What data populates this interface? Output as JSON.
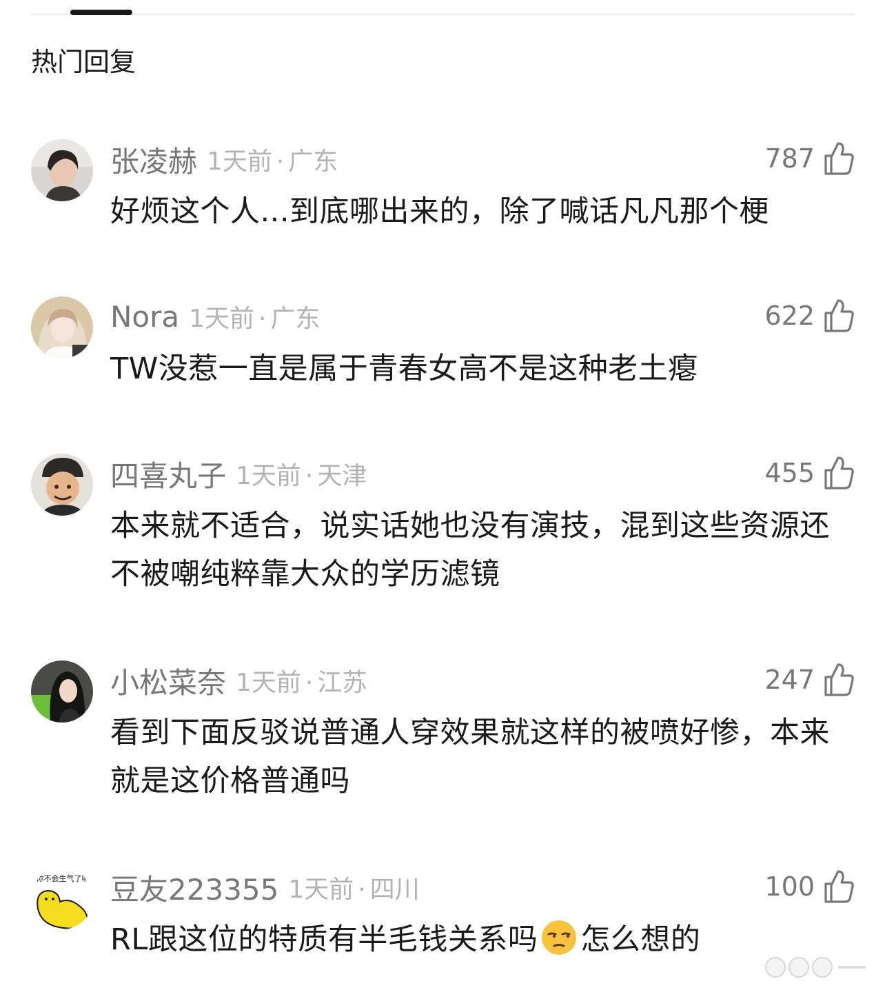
{
  "section": {
    "title": "热门回复"
  },
  "comments": [
    {
      "username": "张凌赫",
      "time": "1天前",
      "location": "广东",
      "likes": "787",
      "text": "好烦这个人...到底哪出来的，除了喊话凡凡那个梗",
      "avatar": "avatar-young-man"
    },
    {
      "username": "Nora",
      "time": "1天前",
      "location": "广东",
      "likes": "622",
      "text": "TW没惹一直是属于青春女高不是这种老土瘪",
      "avatar": "avatar-young-woman"
    },
    {
      "username": "四喜丸子",
      "time": "1天前",
      "location": "天津",
      "likes": "455",
      "text": "本来就不适合，说实话她也没有演技，混到这些资源还不被嘲纯粹靠大众的学历滤镜",
      "avatar": "avatar-man-with-cap"
    },
    {
      "username": "小松菜奈",
      "time": "1天前",
      "location": "江苏",
      "likes": "247",
      "text": "看到下面反驳说普通人穿效果就这样的被喷好惨，本来就是这价格普通吗",
      "avatar": "avatar-woman-dark-hair"
    },
    {
      "username": "豆友223355",
      "time": "1天前",
      "location": "四川",
      "likes": "100",
      "text_before": "RL跟这位的特质有半毛钱关系吗",
      "text_after": "怎么想的",
      "emoji": "unamused-face",
      "avatar": "avatar-yellow-cartoon",
      "avatar_caption": "你不会生气了叭"
    }
  ],
  "icons": {
    "like": "thumbs-up-icon",
    "dot": "·"
  }
}
